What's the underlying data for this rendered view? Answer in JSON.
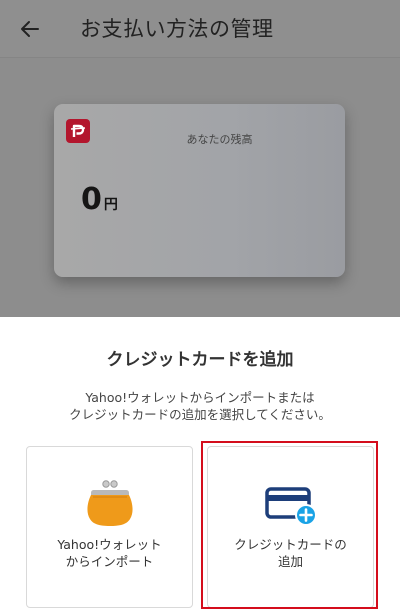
{
  "header": {
    "title": "お支払い方法の管理"
  },
  "balance_card": {
    "label": "あなたの残高",
    "amount": "0",
    "unit": "円"
  },
  "sheet": {
    "title": "クレジットカードを追加",
    "description_line1": "Yahoo!ウォレットからインポートまたは",
    "description_line2": "クレジットカードの追加を選択してください。",
    "options": [
      {
        "line1": "Yahoo!ウォレット",
        "line2": "からインポート",
        "icon": "wallet-purse-icon"
      },
      {
        "line1": "クレジットカードの",
        "line2": "追加",
        "icon": "credit-card-add-icon"
      }
    ]
  },
  "colors": {
    "brand_red": "#b3162d",
    "highlight_red": "#d40d1c",
    "wallet_orange": "#ef9a1a",
    "card_navy": "#1d3e7a",
    "plus_blue": "#1aa3e6"
  }
}
